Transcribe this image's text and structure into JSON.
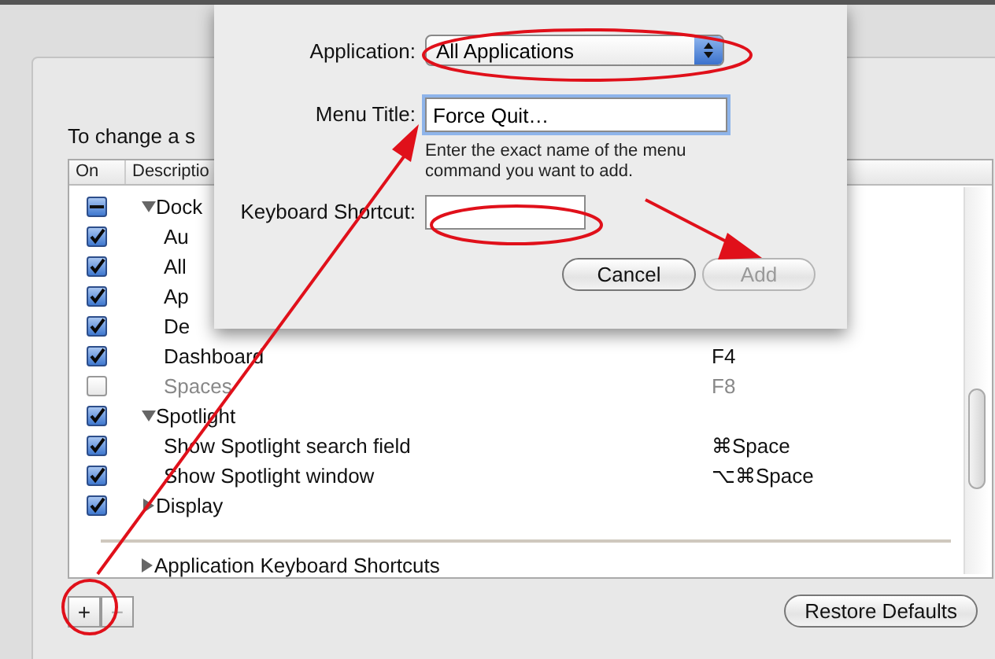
{
  "sheet": {
    "application_label": "Application:",
    "application_value": "All Applications",
    "menu_title_label": "Menu Title:",
    "menu_title_value": "Force Quit…",
    "hint": "Enter the exact name of the menu command you want to add.",
    "shortcut_label": "Keyboard Shortcut:",
    "buttons": [
      {
        "label": "Cancel",
        "disabled": false
      },
      {
        "label": "Add",
        "disabled": true
      }
    ]
  },
  "instruction": "To change a s",
  "table": {
    "columns": [
      "On",
      "Descriptio"
    ],
    "rows": [
      {
        "label": "Dock",
        "checked": true,
        "mixed": true,
        "expanded": true,
        "children": [
          {
            "label": "Au",
            "checked": true
          },
          {
            "label": "All",
            "checked": true
          },
          {
            "label": "Ap",
            "checked": true
          },
          {
            "label": "De",
            "checked": true
          },
          {
            "label": "Dashboard",
            "checked": true,
            "shortcut": "F4"
          },
          {
            "label": "Spaces",
            "checked": false,
            "disabled": true,
            "shortcut": "F8"
          }
        ]
      },
      {
        "label": "Spotlight",
        "checked": true,
        "expanded": true,
        "children": [
          {
            "label": "Show Spotlight search field",
            "checked": true,
            "shortcut": "⌘Space"
          },
          {
            "label": "Show Spotlight window",
            "checked": true,
            "shortcut": "⌥⌘Space"
          }
        ]
      },
      {
        "label": "Display",
        "checked": true,
        "expanded": false
      }
    ],
    "footer_row": {
      "label": "Application Keyboard Shortcuts",
      "expanded": false
    }
  },
  "add_button": {
    "label": "+",
    "disabled": false
  },
  "remove_button": {
    "label": "−",
    "disabled": true
  },
  "restore_button": "Restore Defaults"
}
